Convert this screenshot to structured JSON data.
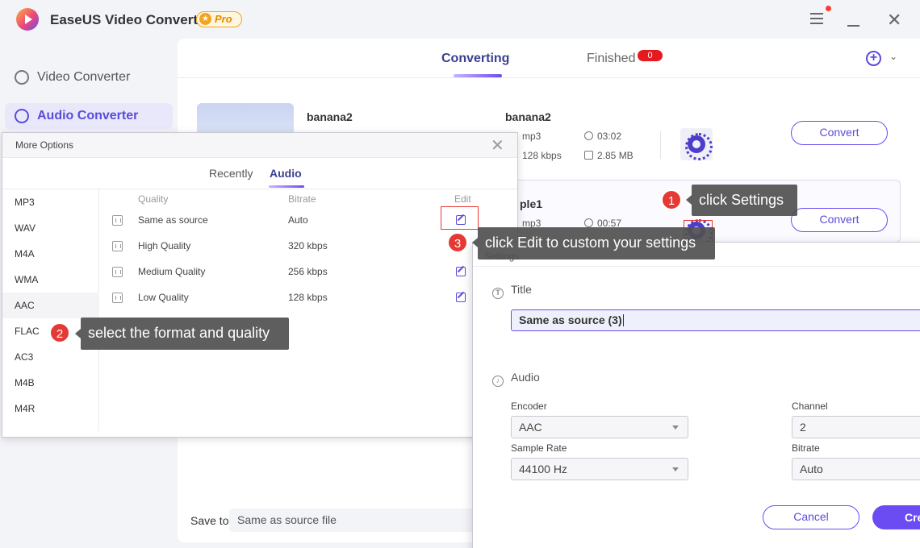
{
  "app": {
    "title": "EaseUS Video Converter",
    "badge": "Pro"
  },
  "sidebar": {
    "items": [
      {
        "label": "Video Converter"
      },
      {
        "label": "Audio Converter"
      }
    ]
  },
  "tabs": {
    "converting": "Converting",
    "finished": "Finished",
    "finished_count": "0"
  },
  "files": [
    {
      "source_name": "banana2",
      "output_name": "banana2",
      "format": "mp3",
      "duration": "03:02",
      "bitrate": "128 kbps",
      "size": "2.85 MB",
      "convert": "Convert"
    },
    {
      "output_name_partial": "ple1",
      "format": "mp3",
      "duration": "00:57",
      "convert": "Convert"
    }
  ],
  "save_to": {
    "label": "Save to:",
    "value": "Same as source file"
  },
  "more_options": {
    "title": "More Options",
    "tabs": [
      "Recently",
      "Audio"
    ],
    "formats": [
      "MP3",
      "WAV",
      "M4A",
      "WMA",
      "AAC",
      "FLAC",
      "AC3",
      "M4B",
      "M4R"
    ],
    "columns": {
      "quality": "Quality",
      "bitrate": "Bitrate",
      "edit": "Edit"
    },
    "qualities": [
      {
        "name": "Same as source",
        "bitrate": "Auto"
      },
      {
        "name": "High Quality",
        "bitrate": "320 kbps"
      },
      {
        "name": "Medium Quality",
        "bitrate": "256 kbps"
      },
      {
        "name": "Low Quality",
        "bitrate": "128 kbps"
      }
    ]
  },
  "settings": {
    "title": "Settings",
    "title_section": "Title",
    "title_value": "Same as source (3)",
    "audio_section": "Audio",
    "encoder_label": "Encoder",
    "encoder": "AAC",
    "channel_label": "Channel",
    "channel": "2",
    "sample_rate_label": "Sample Rate",
    "sample_rate": "44100 Hz",
    "bitrate_label": "Bitrate",
    "bitrate": "Auto",
    "cancel": "Cancel",
    "create_partial": "Cre"
  },
  "tips": [
    {
      "step": "1",
      "text": "click Settings"
    },
    {
      "step": "2",
      "text": "select the format and quality"
    },
    {
      "step": "3",
      "text": "click Edit to custom your settings"
    }
  ],
  "colors": {
    "accent": "#6b4cf2",
    "badge_red": "#e6191f",
    "step_red": "#e53935"
  }
}
